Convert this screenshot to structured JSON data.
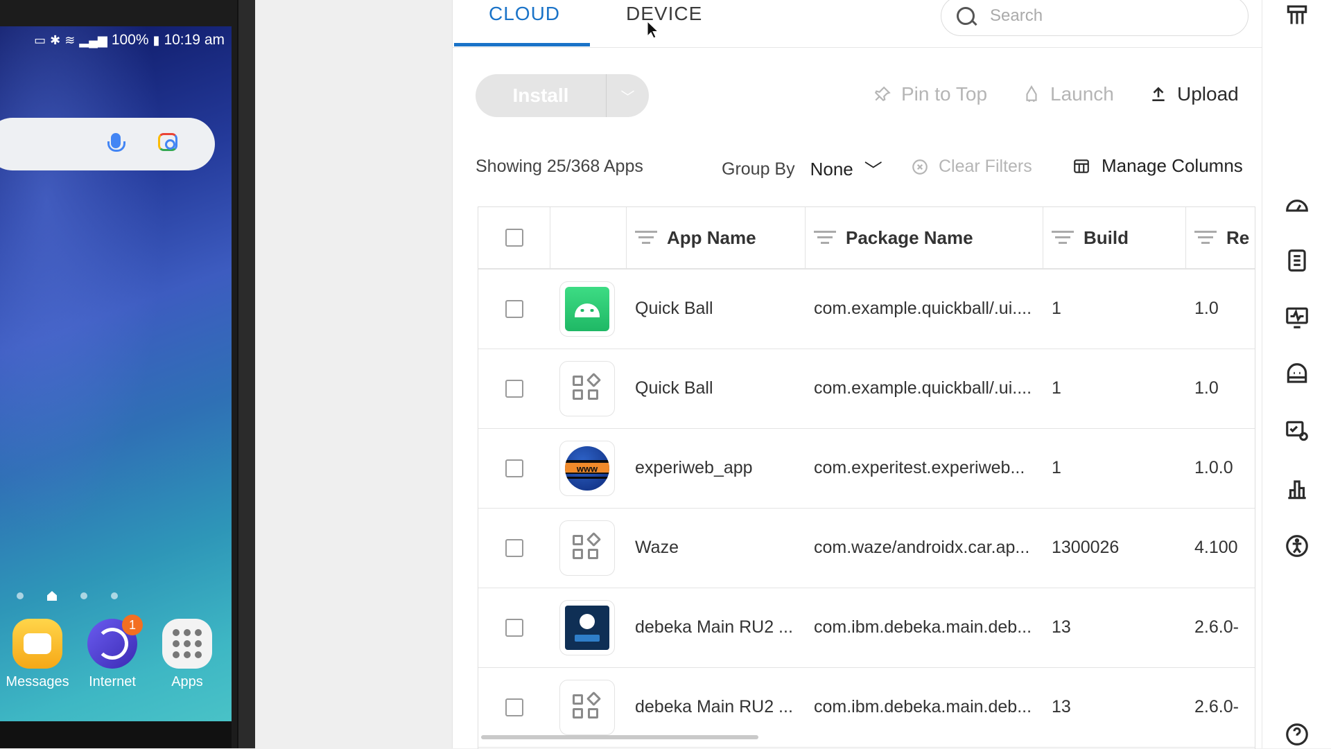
{
  "phone": {
    "status": {
      "battery": "100%",
      "time": "10:19 am"
    },
    "dock": [
      {
        "label": "Messages",
        "icon": "messages-icon"
      },
      {
        "label": "Internet",
        "icon": "internet-icon",
        "badge": "1"
      },
      {
        "label": "Apps",
        "icon": "apps-grid-icon"
      }
    ]
  },
  "tabs": [
    {
      "label": "CLOUD",
      "active": true
    },
    {
      "label": "DEVICE",
      "active": false
    }
  ],
  "search": {
    "placeholder": "Search",
    "value": ""
  },
  "toolbar": {
    "install": "Install",
    "pin_to_top": "Pin to Top",
    "launch": "Launch",
    "upload": "Upload"
  },
  "filters": {
    "showing": "Showing 25/368 Apps",
    "group_by_label": "Group By",
    "group_by_value": "None",
    "clear_filters": "Clear Filters",
    "manage_columns": "Manage Columns"
  },
  "table": {
    "columns": [
      "App Name",
      "Package Name",
      "Build",
      "Re"
    ],
    "rows": [
      {
        "icon": "android-icon",
        "app_name": "Quick Ball",
        "package": "com.example.quickball/.ui....",
        "build": "1",
        "release": "1.0"
      },
      {
        "icon": "generic-app-icon",
        "app_name": "Quick Ball",
        "package": "com.example.quickball/.ui....",
        "build": "1",
        "release": "1.0"
      },
      {
        "icon": "www-globe-icon",
        "app_name": "experiweb_app",
        "package": "com.experitest.experiweb...",
        "build": "1",
        "release": "1.0.0"
      },
      {
        "icon": "generic-app-icon",
        "app_name": "Waze",
        "package": "com.waze/androidx.car.ap...",
        "build": "1300026",
        "release": "4.100"
      },
      {
        "icon": "debeka-icon",
        "app_name": "debeka Main RU2 ...",
        "package": "com.ibm.debeka.main.deb...",
        "build": "13",
        "release": "2.6.0-"
      },
      {
        "icon": "generic-app-icon",
        "app_name": "debeka Main RU2 ...",
        "package": "com.ibm.debeka.main.deb...",
        "build": "13",
        "release": "2.6.0-"
      }
    ]
  },
  "colors": {
    "accent": "#1a73c8",
    "disabled": "#b5b5b5"
  }
}
